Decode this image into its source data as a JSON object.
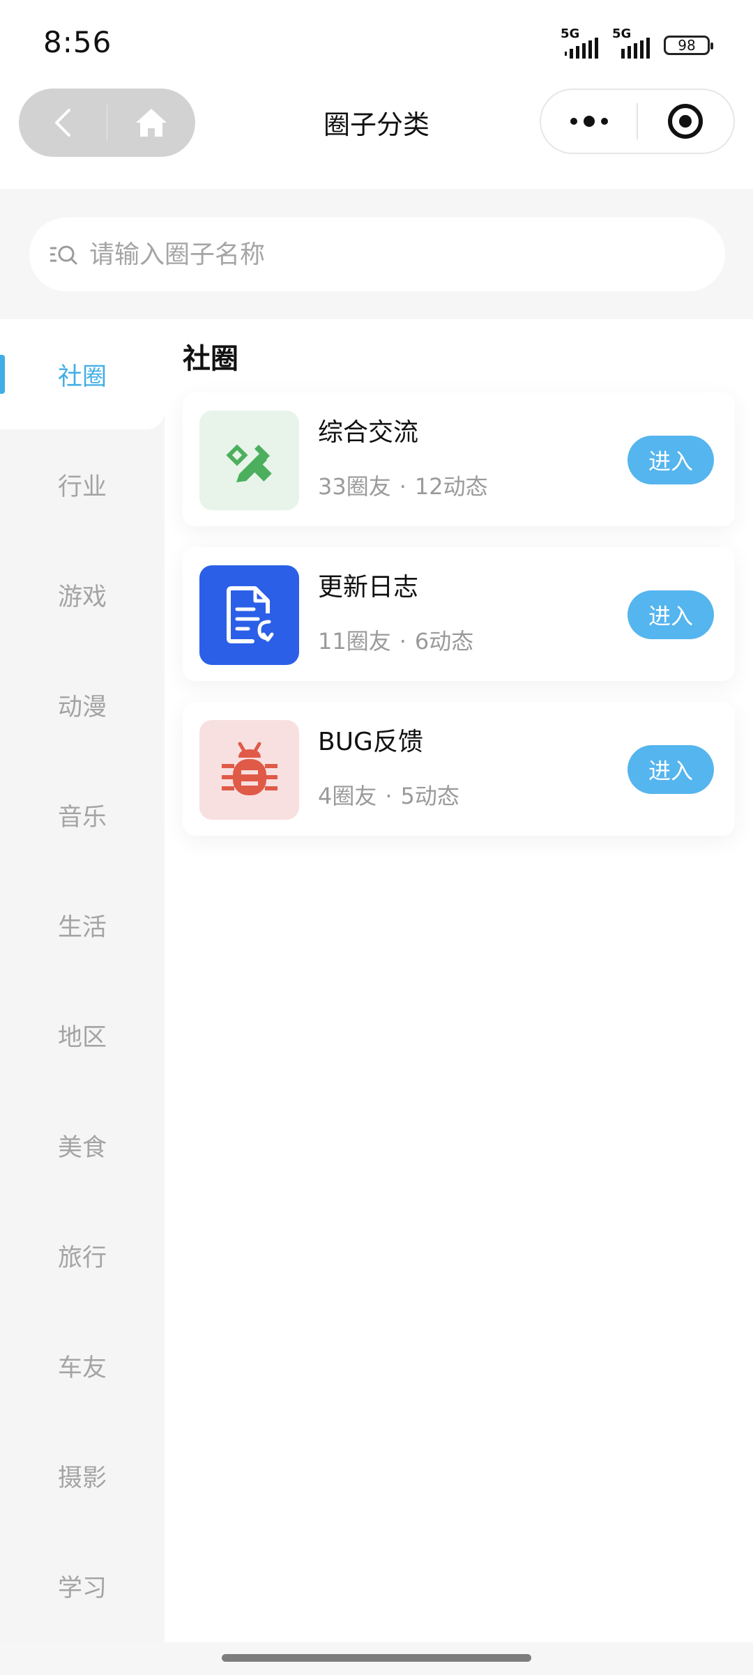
{
  "status_bar": {
    "time": "8:56",
    "signal_1": "5G",
    "signal_2": "5G",
    "battery": "98"
  },
  "nav": {
    "title": "圈子分类",
    "icons": {
      "back": "chevron-left-icon",
      "home": "home-icon",
      "more": "more-dots-icon",
      "close": "target-close-icon"
    }
  },
  "search": {
    "placeholder": "请输入圈子名称",
    "icon": "search-list-icon"
  },
  "sidebar": {
    "items": [
      {
        "label": "社圈",
        "active": true
      },
      {
        "label": "行业",
        "active": false
      },
      {
        "label": "游戏",
        "active": false
      },
      {
        "label": "动漫",
        "active": false
      },
      {
        "label": "音乐",
        "active": false
      },
      {
        "label": "生活",
        "active": false
      },
      {
        "label": "地区",
        "active": false
      },
      {
        "label": "美食",
        "active": false
      },
      {
        "label": "旅行",
        "active": false
      },
      {
        "label": "车友",
        "active": false
      },
      {
        "label": "摄影",
        "active": false
      },
      {
        "label": "学习",
        "active": false
      }
    ]
  },
  "main": {
    "section_title": "社圈",
    "circles": [
      {
        "name": "综合交流",
        "members": "33圈友",
        "posts": "12动态",
        "dot": "·",
        "button": "进入",
        "icon": "pencil-ruler-icon",
        "icon_bg": "#e8f4ea",
        "icon_color": "#4caf5e"
      },
      {
        "name": "更新日志",
        "members": "11圈友",
        "posts": "6动态",
        "dot": "·",
        "button": "进入",
        "icon": "document-edit-icon",
        "icon_bg": "#2c5fe8",
        "icon_color": "#ffffff"
      },
      {
        "name": "BUG反馈",
        "members": "4圈友",
        "posts": "5动态",
        "dot": "·",
        "button": "进入",
        "icon": "bug-icon",
        "icon_bg": "#f8e0e0",
        "icon_color": "#e05a48"
      }
    ]
  },
  "colors": {
    "accent": "#41aee6",
    "button": "#55b5ee"
  }
}
